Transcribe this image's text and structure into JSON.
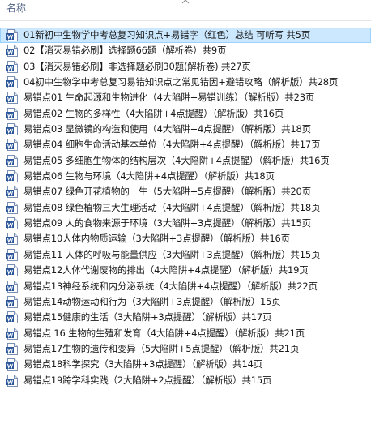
{
  "header": {
    "name_column": "名称"
  },
  "colors": {
    "selected_bg": "#cce8ff",
    "word_icon": "#2b579a"
  },
  "files": [
    {
      "name": "01新初中生物学中考总复习知识点+易错字（红色）总结 可听写 共5页",
      "icon": "word-doc-icon",
      "selected": true
    },
    {
      "name": "02【消灭易错必刷】选择题66题（解析卷）共9页",
      "icon": "word-doc-icon"
    },
    {
      "name": "03【消灭易错必刷】非选择题必刷30题(解析卷) 共27页",
      "icon": "word-doc-icon"
    },
    {
      "name": "04初中生物学中考总复习易错知识点之常见错因+避错攻略（解析版）共28页",
      "icon": "word-doc-icon"
    },
    {
      "name": "易错点01 生命起源和生物进化（4大陷阱+易错训练）（解析版）共23页",
      "icon": "word-doc-icon"
    },
    {
      "name": "易错点02 生物的多样性（4大陷阱+4点提醒）（解析版）共16页",
      "icon": "word-doc-icon"
    },
    {
      "name": "易错点03 显微镜的构造和使用（4大陷阱+4点提醒）（解析版）共18页",
      "icon": "word-doc-icon"
    },
    {
      "name": "易错点04 细胞生命活动基本单位（4大陷阱+4点提醒）（解析版）共17页",
      "icon": "word-doc-icon"
    },
    {
      "name": "易错点05 多细胞生物体的结构层次（4大陷阱+4点提醒）（解析版）共16页",
      "icon": "word-doc-icon"
    },
    {
      "name": "易错点06 生物与环境（4大陷阱+4点提醒）（解析版）共18页",
      "icon": "word-doc-icon"
    },
    {
      "name": "易错点07 绿色开花植物的一生（5大陷阱+5点提醒）（解析版）共20页",
      "icon": "word-doc-icon"
    },
    {
      "name": "易错点08 绿色植物三大生理活动（4大陷阱+4点提醒）（解析版）共18页",
      "icon": "word-doc-icon"
    },
    {
      "name": "易错点09 人的食物来源于环境（3大陷阱+3点提醒）（解析版）共15页",
      "icon": "word-doc-icon"
    },
    {
      "name": "易错点10人体内物质运输（3大陷阱+3点提醒）（解析版）共16页",
      "icon": "word-doc-icon"
    },
    {
      "name": "易错点11 人体的呼吸与能量供应（3大陷阱+3点提醒）（解析版）共15页",
      "icon": "word-doc-icon"
    },
    {
      "name": "易错点12人体代谢废物的排出（4大陷阱+4点提醒）（解析版）共19页",
      "icon": "word-doc-icon"
    },
    {
      "name": "易错点13神经系统和内分泌系统（4大陷阱+4点提醒）（解析版）共22页",
      "icon": "word-doc-icon"
    },
    {
      "name": "易错点14动物运动和行为（3大陷阱+3点提醒）（解析版）15页",
      "icon": "word-doc-icon"
    },
    {
      "name": "易错点15健康的生活（3大陷阱+3点提醒）（解析版）共17页",
      "icon": "word-doc-icon"
    },
    {
      "name": "易错点 16 生物的生殖和发育（4大陷阱+4点提醒）（解析版）共21页",
      "icon": "word-doc-icon"
    },
    {
      "name": "易错点17生物的遗传和变异（5大陷阱+5点提醒）（解析版）共21页",
      "icon": "word-doc-icon"
    },
    {
      "name": "易错点18科学探究（3大陷阱+3点提醒）（解析版）共14页",
      "icon": "word-doc-icon"
    },
    {
      "name": "易错点19跨学科实践（2大陷阱+2点提醒）（解析版）共15页",
      "icon": "word-doc-icon"
    }
  ]
}
